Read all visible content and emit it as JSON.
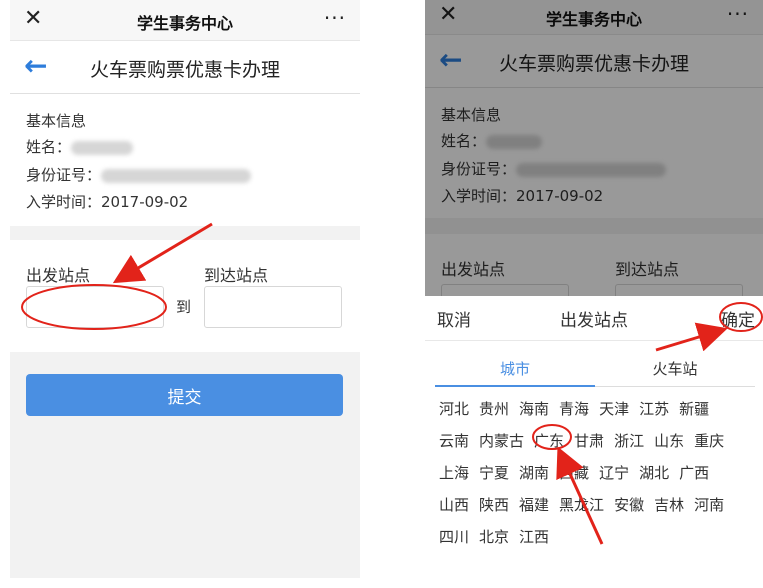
{
  "wechat": {
    "close_glyph": "✕",
    "title": "学生事务中心",
    "more_glyph": "···"
  },
  "nav": {
    "back_glyph": "←",
    "title": "火车票购票优惠卡办理"
  },
  "info": {
    "section_title": "基本信息",
    "name_label": "姓名：",
    "id_label": "身份证号：",
    "enroll_label": "入学时间：",
    "enroll_value": "2017-09-02"
  },
  "stations": {
    "from_label": "出发站点",
    "to_label": "到达站点",
    "connector": "到",
    "from_value": "",
    "to_value": ""
  },
  "submit_label": "提交",
  "picker": {
    "cancel_label": "取消",
    "title": "出发站点",
    "confirm_label": "确定",
    "tab_city": "城市",
    "tab_station": "火车站",
    "provinces": [
      "河北",
      "贵州",
      "海南",
      "青海",
      "天津",
      "江苏",
      "新疆",
      "云南",
      "内蒙古",
      "广东",
      "甘肃",
      "浙江",
      "山东",
      "重庆",
      "上海",
      "宁夏",
      "湖南",
      "西藏",
      "辽宁",
      "湖北",
      "广西",
      "山西",
      "陕西",
      "福建",
      "黑龙江",
      "安徽",
      "吉林",
      "河南",
      "四川",
      "北京",
      "江西"
    ]
  },
  "colors": {
    "accent": "#4a8fe2",
    "annotation": "#e2231a"
  }
}
